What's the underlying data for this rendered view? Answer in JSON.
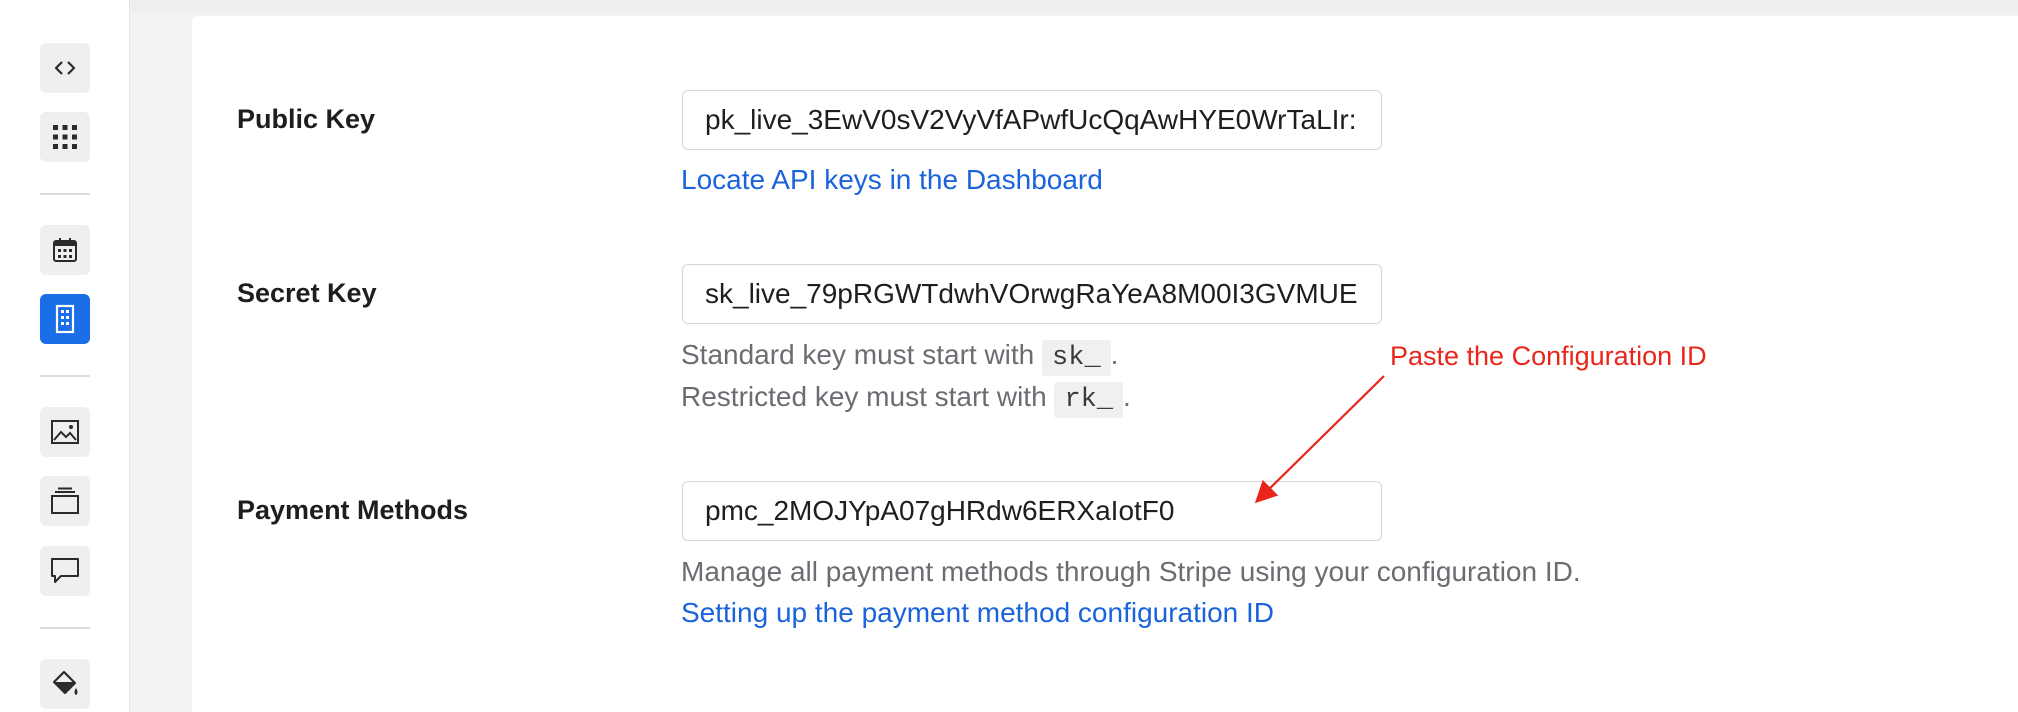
{
  "sidebar": {
    "tools": [
      {
        "icon": "code-icon",
        "active": false
      },
      {
        "icon": "grid-icon",
        "active": false
      },
      {
        "icon": "calendar-icon",
        "active": false
      },
      {
        "icon": "building-icon",
        "active": true
      },
      {
        "icon": "image-icon",
        "active": false
      },
      {
        "icon": "layers-icon",
        "active": false
      },
      {
        "icon": "comment-icon",
        "active": false
      },
      {
        "icon": "paint-bucket-icon",
        "active": false
      }
    ]
  },
  "form": {
    "public_key": {
      "label": "Public Key",
      "value": "pk_live_3EwV0sV2VyVfAPwfUcQqAwHYE0WrTaLIr:",
      "link": "Locate API keys in the Dashboard"
    },
    "secret_key": {
      "label": "Secret Key",
      "value": "sk_live_79pRGWTdwhVOrwgRaYeA8M00I3GVMUE",
      "help_standard_prefix": "Standard key must start with",
      "help_standard_code": "sk_",
      "help_standard_suffix": ".",
      "help_restricted_prefix": "Restricted key must start with",
      "help_restricted_code": "rk_",
      "help_restricted_suffix": "."
    },
    "payment_methods": {
      "label": "Payment Methods",
      "value": "pmc_2MOJYpA07gHRdw6ERXaIotF0",
      "help": "Manage all payment methods through Stripe using your configuration ID.",
      "link": "Setting up the payment method configuration ID"
    }
  },
  "annotation": {
    "text": "Paste the Configuration ID",
    "color": "#e8261b"
  },
  "colors": {
    "accent": "#1a6ee8",
    "link": "#1a63dc"
  }
}
